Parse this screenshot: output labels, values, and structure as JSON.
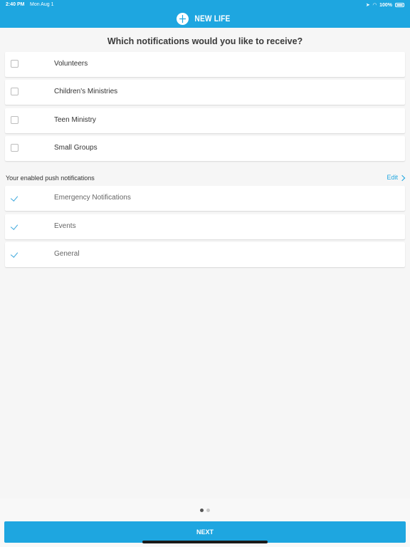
{
  "status_bar": {
    "time": "2:40 PM",
    "date": "Mon Aug 1",
    "battery": "100%"
  },
  "brand": {
    "name": "NEW LIFE",
    "color": "#1ea6e0"
  },
  "question": "Which notifications would you like to receive?",
  "options": [
    {
      "label": "Volunteers",
      "checked": false
    },
    {
      "label": "Children's Ministries",
      "checked": false
    },
    {
      "label": "Teen Ministry",
      "checked": false
    },
    {
      "label": "Small Groups",
      "checked": false
    }
  ],
  "enabled_section": {
    "title": "Your enabled push notifications",
    "edit_label": "Edit",
    "items": [
      {
        "label": "Emergency Notifications",
        "enabled": true
      },
      {
        "label": "Events",
        "enabled": true
      },
      {
        "label": "General",
        "enabled": true
      }
    ]
  },
  "pager": {
    "pages": 2,
    "current": 1
  },
  "next_button_label": "NEXT"
}
